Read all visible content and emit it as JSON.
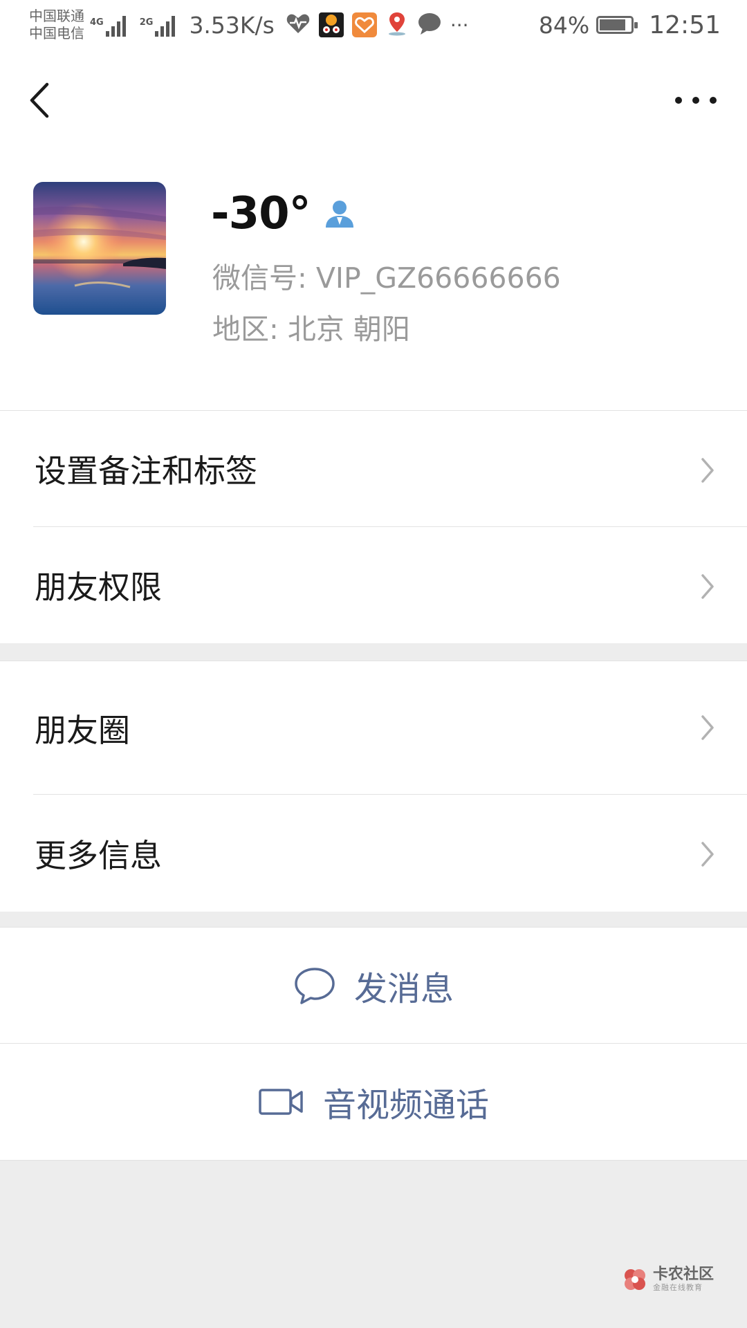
{
  "status_bar": {
    "carrier_1": "中国联通",
    "carrier_2": "中国电信",
    "signal_1": "4G",
    "signal_2": "2G",
    "net_speed": "3.53K/s",
    "battery_percent": "84%",
    "battery_level": 0.84,
    "time": "12:51",
    "notif_icons": [
      "heart-monitor-icon",
      "app-face-icon",
      "health-heart-icon",
      "map-pin-icon",
      "chat-bubble-icon"
    ],
    "more_indicator": "···"
  },
  "profile": {
    "nickname": "-30°",
    "wechat_id": "微信号: VIP_GZ66666666",
    "region": "地区: 北京  朝阳"
  },
  "menu_group_1": [
    {
      "label": "设置备注和标签"
    },
    {
      "label": "朋友权限"
    }
  ],
  "menu_group_2": [
    {
      "label": "朋友圈"
    },
    {
      "label": "更多信息"
    }
  ],
  "actions": {
    "send_message": "发消息",
    "av_call": "音视频通话"
  },
  "watermark": {
    "title": "卡农社区",
    "subtitle": "金融在线教育"
  },
  "colors": {
    "link": "#576b95",
    "background": "#ededed",
    "card": "#ffffff",
    "verified_icon": "#5a9fdb"
  }
}
